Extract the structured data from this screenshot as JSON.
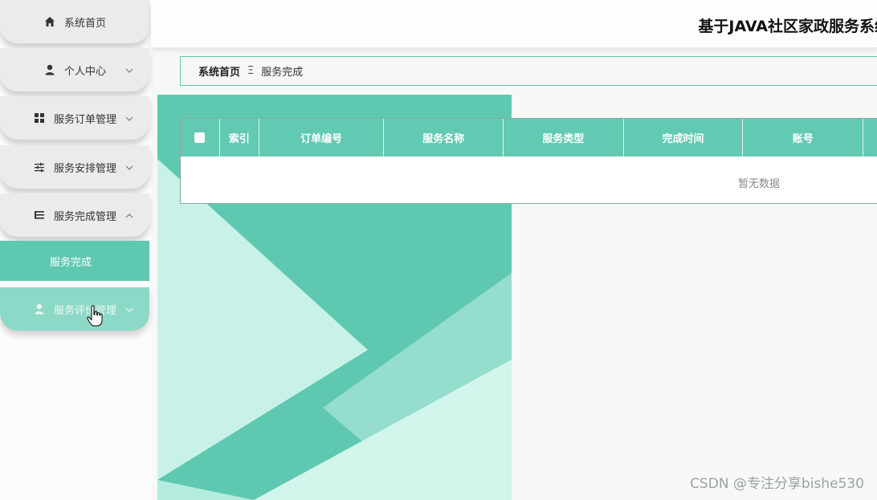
{
  "sidebar": {
    "items": [
      {
        "label": "系统首页",
        "icon": "home-icon"
      },
      {
        "label": "个人中心",
        "icon": "user-icon"
      },
      {
        "label": "服务订单管理",
        "icon": "grid-icon"
      },
      {
        "label": "服务安排管理",
        "icon": "sliders-icon"
      },
      {
        "label": "服务完成管理",
        "icon": "list-icon"
      },
      {
        "label": "服务评价管理",
        "icon": "user-icon"
      }
    ],
    "submenu_active": "服务完成"
  },
  "header": {
    "title": "基于JAVA社区家政服务系统"
  },
  "breadcrumb": {
    "home": "系统首页",
    "separator": "Ξ",
    "current": "服务完成"
  },
  "table": {
    "columns": [
      "索引",
      "订单编号",
      "服务名称",
      "服务类型",
      "完成时间",
      "账号"
    ],
    "empty_text": "暂无数据"
  },
  "watermark": "CSDN @专注分享bishe530",
  "colors": {
    "accent": "#5fc8b0",
    "accent_light": "#c8f2e8"
  }
}
